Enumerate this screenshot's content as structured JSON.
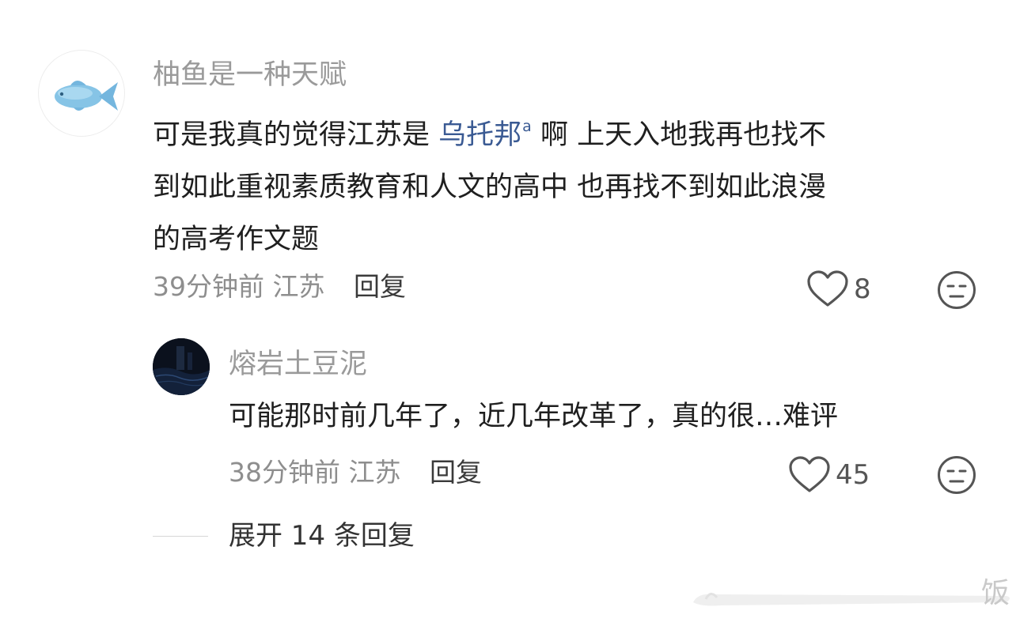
{
  "comment": {
    "username": "柚鱼是一种天赋",
    "text_line1_before": "可是我真的觉得江苏是 ",
    "topic_link": "乌托邦",
    "text_line1_after": " 啊 上天入地我再也找不",
    "text_line2": "到如此重视素质教育和人文的高中 也再找不到如此浪漫",
    "text_line3": "的高考作文题",
    "time": "39分钟前",
    "location": "江苏",
    "reply_label": "回复",
    "likes": "8"
  },
  "reply": {
    "username": "熔岩土豆泥",
    "text": "可能那时前几年了，近几年改革了，真的很…难评",
    "time": "38分钟前",
    "location": "江苏",
    "reply_label": "回复",
    "likes": "45"
  },
  "expand_replies": "展开 14 条回复",
  "watermark_char": "饭",
  "colors": {
    "username": "#9a9a9a",
    "topic_link": "#3a5a93",
    "meta": "#8e8e8e",
    "text": "#1f1f1f"
  }
}
